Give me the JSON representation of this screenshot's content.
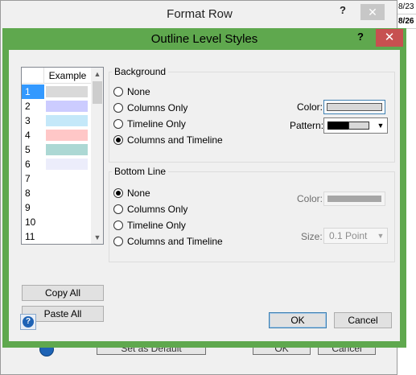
{
  "background_window": {
    "title": "Format Row",
    "help_label": "?",
    "close_label": "✕",
    "sheet_cells": [
      "8/23",
      "8/26"
    ],
    "buttons": {
      "set_default": "Set as Default",
      "ok": "OK",
      "cancel": "Cancel"
    }
  },
  "dialog": {
    "title": "Outline Level Styles",
    "help_label": "?",
    "close_label": "✕"
  },
  "levels": {
    "header": "Example",
    "selected_index": 0,
    "items": [
      {
        "label": "1",
        "color": "#d9d9d9"
      },
      {
        "label": "2",
        "color": "#ccccff"
      },
      {
        "label": "3",
        "color": "#c4e8f9"
      },
      {
        "label": "4",
        "color": "#ffc7c7"
      },
      {
        "label": "5",
        "color": "#acd8d4"
      },
      {
        "label": "6",
        "color": "#ecedfb"
      },
      {
        "label": "7",
        "color": ""
      },
      {
        "label": "8",
        "color": ""
      },
      {
        "label": "9",
        "color": ""
      },
      {
        "label": "10",
        "color": ""
      },
      {
        "label": "11",
        "color": ""
      }
    ]
  },
  "list_buttons": {
    "copy_all": "Copy All",
    "paste_all": "Paste All"
  },
  "background_group": {
    "title": "Background",
    "options": [
      "None",
      "Columns Only",
      "Timeline Only",
      "Columns and Timeline"
    ],
    "selected": "Columns and Timeline",
    "color_label": "Color:",
    "pattern_label": "Pattern:"
  },
  "bottom_line_group": {
    "title": "Bottom Line",
    "options": [
      "None",
      "Columns Only",
      "Timeline Only",
      "Columns and Timeline"
    ],
    "selected": "None",
    "color_label": "Color:",
    "size_label": "Size:",
    "size_value": "0.1 Point"
  },
  "footer": {
    "ok": "OK",
    "cancel": "Cancel"
  },
  "colors": {
    "dialog_frame": "#5fa84e",
    "close_button": "#c75050",
    "selection": "#3399ff"
  }
}
